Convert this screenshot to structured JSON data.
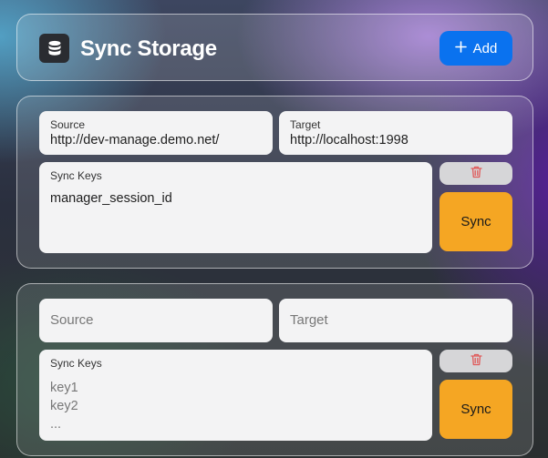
{
  "header": {
    "title": "Sync Storage",
    "logo_icon": "database-icon",
    "add_label": "Add",
    "add_icon": "plus-icon",
    "accent_color": "#0a72ef"
  },
  "entries": [
    {
      "source": {
        "label": "Source",
        "value": "http://dev-manage.demo.net/"
      },
      "target": {
        "label": "Target",
        "value": "http://localhost:1998"
      },
      "sync_keys": {
        "label": "Sync Keys",
        "value": "manager_session_id"
      },
      "delete_icon": "trash-icon",
      "sync_label": "Sync"
    },
    {
      "source": {
        "placeholder": "Source"
      },
      "target": {
        "placeholder": "Target"
      },
      "sync_keys": {
        "label": "Sync Keys",
        "placeholder": "key1\nkey2\n..."
      },
      "delete_icon": "trash-icon",
      "sync_label": "Sync"
    }
  ],
  "colors": {
    "sync_button": "#f5a623",
    "delete_icon": "#e05a5a"
  }
}
